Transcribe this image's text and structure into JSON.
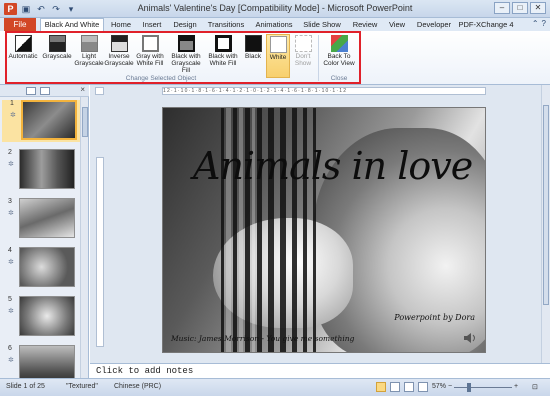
{
  "window": {
    "title": "Animals' Valentine's Day [Compatibility Mode]  -  Microsoft PowerPoint",
    "app_icon": "P",
    "controls": [
      "–",
      "□",
      "✕"
    ]
  },
  "tabs": {
    "file": "File",
    "items": [
      "Black And White",
      "Home",
      "Insert",
      "Design",
      "Transitions",
      "Animations",
      "Slide Show",
      "Review",
      "View",
      "Developer",
      "PDF-XChange 4"
    ]
  },
  "ribbon": {
    "buttons": [
      {
        "label": "Automatic",
        "icon": "automatic-icon"
      },
      {
        "label": "Grayscale",
        "icon": "grayscale-icon"
      },
      {
        "label": "Light Grayscale",
        "icon": "light-grayscale-icon"
      },
      {
        "label": "Inverse Grayscale",
        "icon": "inverse-grayscale-icon"
      },
      {
        "label": "Gray with White Fill",
        "icon": "gray-white-fill-icon"
      },
      {
        "label": "Black with Grayscale Fill",
        "icon": "black-grayscale-fill-icon"
      },
      {
        "label": "Black with White Fill",
        "icon": "black-white-fill-icon"
      },
      {
        "label": "Black",
        "icon": "black-icon"
      },
      {
        "label": "White",
        "icon": "white-icon"
      },
      {
        "label": "Don't Show",
        "icon": "dont-show-icon"
      }
    ],
    "group_label": "Change Selected Object",
    "close_button": {
      "label": "Back To Color View",
      "icon": "back-to-color-icon"
    },
    "close_group_label": "Close"
  },
  "thumbnails": [
    {
      "num": "1"
    },
    {
      "num": "2"
    },
    {
      "num": "3"
    },
    {
      "num": "4"
    },
    {
      "num": "5"
    },
    {
      "num": "6"
    }
  ],
  "slide": {
    "title": "Animals in love",
    "credit": "Powerpoint  by  Dora",
    "music": "Music: James Morrison - You give me something"
  },
  "ruler": {
    "text": "12·1·10·1·8·1·6·1·4·1·2·1·0·1·2·1·4·1·6·1·8·1·10·1·12"
  },
  "notes": {
    "placeholder": "Click to add notes"
  },
  "status": {
    "slide": "Slide 1 of 25",
    "theme": "\"Textured\"",
    "language": "Chinese (PRC)",
    "zoom": "57%",
    "zoom_level": 0.57
  }
}
